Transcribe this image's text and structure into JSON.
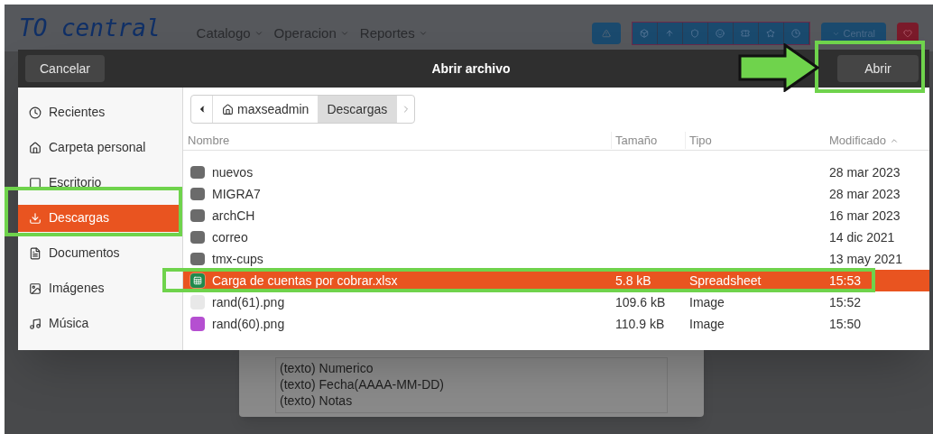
{
  "page": {
    "logo": "TO central",
    "menus": [
      "Catalogo",
      "Operacion",
      "Reportes"
    ],
    "branch_button": "Central",
    "panel_lines": [
      "(texto) Numerico",
      "(texto) Fecha(AAAA-MM-DD)",
      "(texto) Notas"
    ]
  },
  "dialog": {
    "title": "Abrir archivo",
    "cancel": "Cancelar",
    "open": "Abrir",
    "sidebar": [
      {
        "kind": "recent",
        "label": "Recientes",
        "selected": false
      },
      {
        "kind": "home",
        "label": "Carpeta personal",
        "selected": false
      },
      {
        "kind": "desktop",
        "label": "Escritorio",
        "selected": false
      },
      {
        "kind": "download",
        "label": "Descargas",
        "selected": true
      },
      {
        "kind": "documents",
        "label": "Documentos",
        "selected": false
      },
      {
        "kind": "images",
        "label": "Imágenes",
        "selected": false
      },
      {
        "kind": "music",
        "label": "Música",
        "selected": false
      }
    ],
    "path": [
      {
        "label": "maxseadmin",
        "home": true,
        "selected": false
      },
      {
        "label": "Descargas",
        "home": false,
        "selected": true
      }
    ],
    "columns": [
      "Nombre",
      "Tamaño",
      "Tipo",
      "Modificado"
    ],
    "rows": [
      {
        "kind": "folder",
        "name": "nuevos",
        "size": "",
        "type": "",
        "modified": "28 mar 2023",
        "selected": false
      },
      {
        "kind": "folder",
        "name": "MIGRA7",
        "size": "",
        "type": "",
        "modified": "28 mar 2023",
        "selected": false
      },
      {
        "kind": "folder",
        "name": "archCH",
        "size": "",
        "type": "",
        "modified": "16 mar 2023",
        "selected": false
      },
      {
        "kind": "folder",
        "name": "correo",
        "size": "",
        "type": "",
        "modified": "14 dic 2021",
        "selected": false
      },
      {
        "kind": "folder",
        "name": "tmx-cups",
        "size": "",
        "type": "",
        "modified": "13 may 2021",
        "selected": false
      },
      {
        "kind": "spreadsheet",
        "name": "Carga de cuentas por cobrar.xlsx",
        "size": "5.8 kB",
        "type": "Spreadsheet",
        "modified": "15:53",
        "selected": true
      },
      {
        "kind": "image-light",
        "name": "rand(61).png",
        "size": "109.6 kB",
        "type": "Image",
        "modified": "15:52",
        "selected": false
      },
      {
        "kind": "image",
        "name": "rand(60).png",
        "size": "110.9 kB",
        "type": "Image",
        "modified": "15:50",
        "selected": false
      }
    ]
  }
}
